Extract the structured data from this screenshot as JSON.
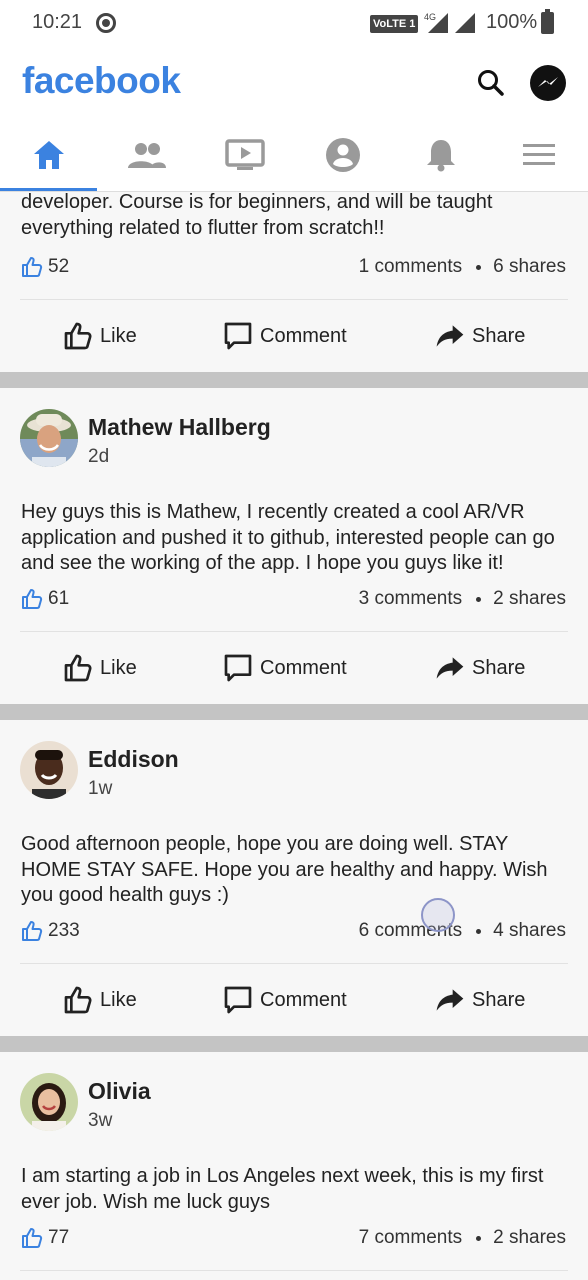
{
  "status_bar": {
    "time": "10:21",
    "network": "VoLTE 1",
    "network_gen": "4G",
    "battery": "100%"
  },
  "app": {
    "brand": "facebook"
  },
  "tabs": [
    {
      "icon": "home-icon",
      "active": true
    },
    {
      "icon": "friends-icon",
      "active": false
    },
    {
      "icon": "watch-icon",
      "active": false
    },
    {
      "icon": "profile-icon",
      "active": false
    },
    {
      "icon": "notifications-icon",
      "active": false
    },
    {
      "icon": "menu-icon",
      "active": false
    }
  ],
  "colors": {
    "accent": "#3b82e0",
    "separator": "#c4c4c4",
    "background": "#f7f7f7"
  },
  "posts": [
    {
      "author": "",
      "time": "",
      "text": "developer. Course is for beginners, and will be taught everything related to flutter from scratch!!",
      "likes": "52",
      "comments": "1 comments",
      "shares": "6 shares"
    },
    {
      "author": "Mathew Hallberg",
      "time": "2d",
      "text": "Hey guys this is Mathew, I recently created a cool AR/VR application and pushed it to github, interested people can go and see the working of the app. I hope you guys like it!",
      "likes": "61",
      "comments": "3 comments",
      "shares": "2 shares"
    },
    {
      "author": "Eddison",
      "time": "1w",
      "text": "Good afternoon people, hope you are doing well. STAY HOME STAY SAFE. Hope you are healthy and happy. Wish you good health guys :)",
      "likes": "233",
      "comments": "6 comments",
      "shares": "4 shares"
    },
    {
      "author": "Olivia",
      "time": "3w",
      "text": "I am starting a job in Los Angeles next week, this is my first ever job. Wish me luck guys",
      "likes": "77",
      "comments": "7 comments",
      "shares": "2 shares"
    }
  ],
  "actions": {
    "like": "Like",
    "comment": "Comment",
    "share": "Share"
  }
}
